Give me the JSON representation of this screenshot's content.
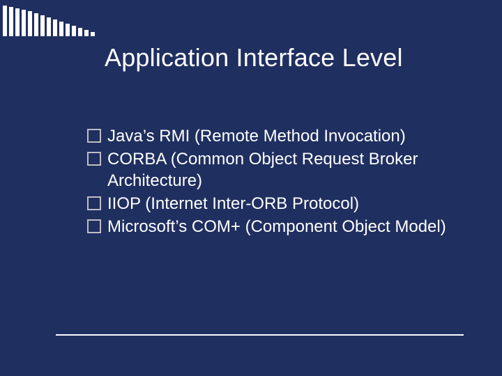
{
  "title": "Application Interface Level",
  "bullets": {
    "b0": "Java’s RMI (Remote Method Invocation)",
    "b1": "CORBA (Common Object Request Broker Architecture)",
    "b2": "IIOP (Internet Inter-ORB Protocol)",
    "b3": "Microsoft’s COM+ (Component Object Model)"
  },
  "decor_heights": [
    44,
    42,
    40,
    38,
    36,
    33,
    30,
    27,
    24,
    21,
    18,
    15,
    12,
    9,
    6
  ]
}
